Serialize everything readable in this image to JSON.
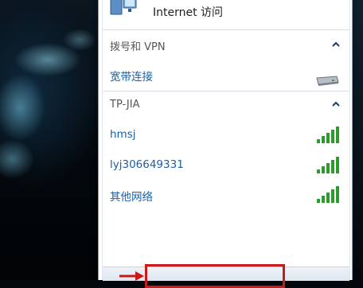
{
  "top": {
    "internet_label": "Internet 访问"
  },
  "sections": [
    {
      "title": "拨号和 VPN",
      "items": [
        {
          "label": "宽带连接",
          "kind": "modem"
        }
      ]
    },
    {
      "title": "TP-JIA",
      "items": [
        {
          "label": "hmsj",
          "kind": "wifi",
          "signal": 5
        },
        {
          "label": "lyj306649331",
          "kind": "wifi",
          "signal": 5
        },
        {
          "label": "其他网络",
          "kind": "wifi",
          "signal": 5
        }
      ]
    }
  ],
  "icons": {
    "network": "network-globe-icon",
    "collapse": "chevron-up-icon",
    "signal": "wifi-signal-icon",
    "modem": "modem-icon"
  },
  "colors": {
    "link": "#1a5fa8",
    "signal": "#2e9a2e",
    "highlight": "#c81a1a"
  }
}
